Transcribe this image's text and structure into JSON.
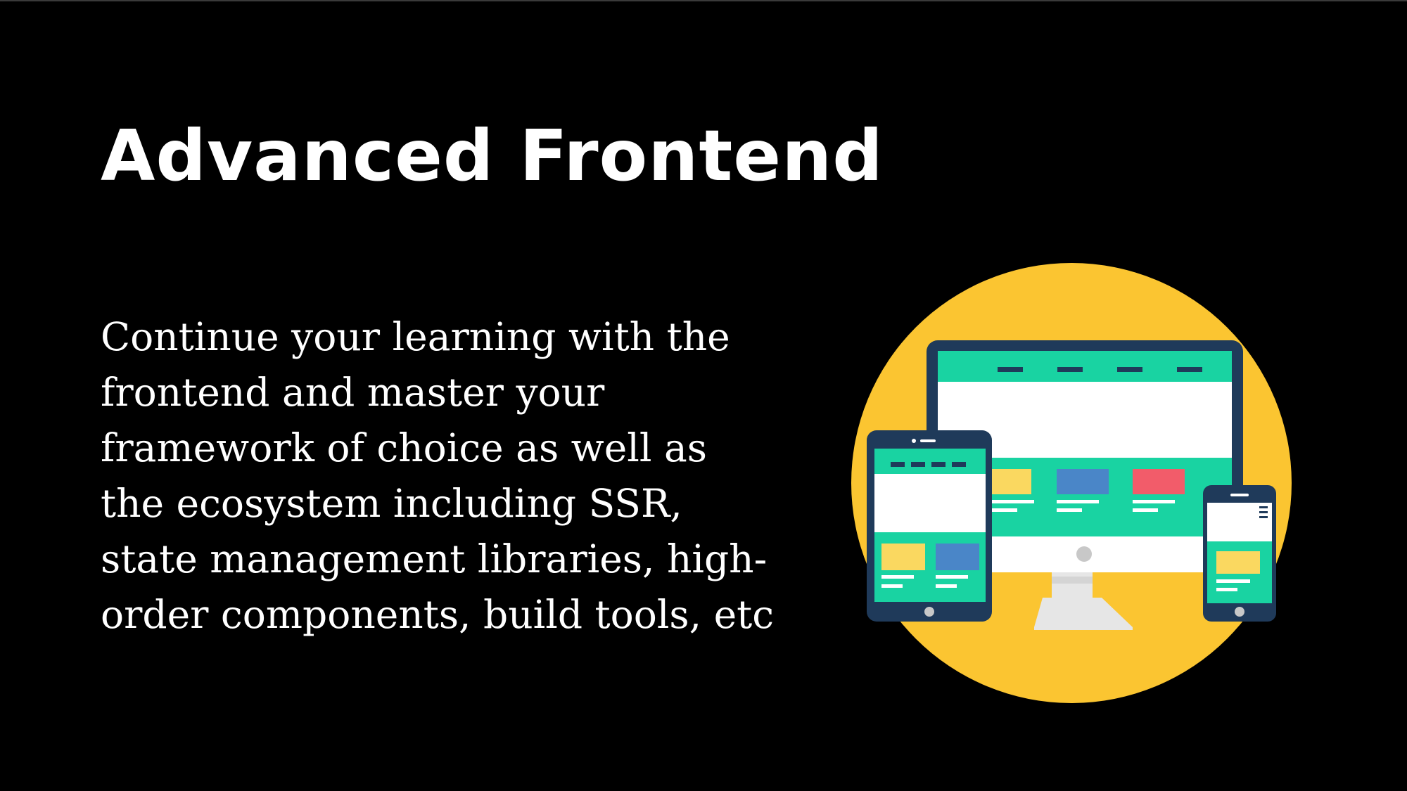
{
  "slide": {
    "title": "Advanced Frontend",
    "body_lines": [
      "Continue your learning with the",
      "frontend and master your",
      "framework of choice as well as",
      "the ecosystem including SSR,",
      "state management libraries, high-",
      "order components, build tools, etc"
    ],
    "illustration": {
      "icon": "responsive-devices-icon",
      "circle_color": "#FBC531",
      "frame_color": "#1F3A5A",
      "header_color": "#19D3A2",
      "accent_colors": [
        "#FAD860",
        "#4A86C8",
        "#F25C6A"
      ]
    }
  }
}
